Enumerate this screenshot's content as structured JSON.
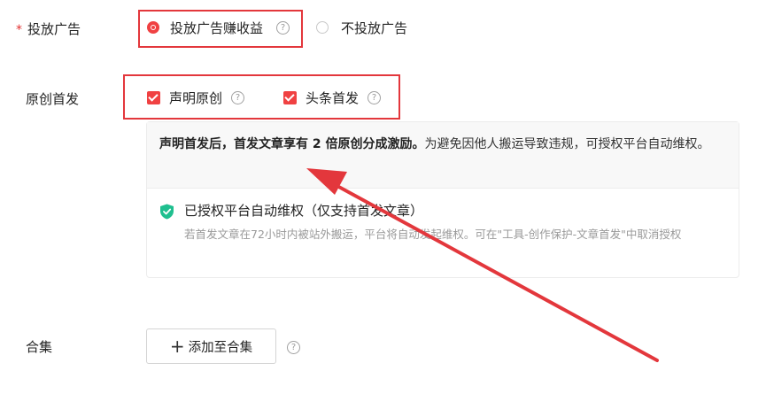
{
  "ad_row": {
    "label": "投放广告",
    "option_on": "投放广告赚收益",
    "option_off": "不投放广告"
  },
  "original_row": {
    "label": "原创首发",
    "declare_original": "声明原创",
    "first_publish": "头条首发"
  },
  "info_panel": {
    "bold_text": "声明首发后，首发文章享有 2 倍原创分成激励。",
    "normal_text": "为避免因他人搬运导致违规，可授权平台自动维权。",
    "auth_title": "已授权平台自动维权（仅支持首发文章）",
    "auth_desc": "若首发文章在72小时内被站外搬运，平台将自动发起维权。可在\"工具-创作保护-文章首发\"中取消授权"
  },
  "collection_row": {
    "label": "合集",
    "add_button": "添加至合集"
  },
  "colors": {
    "accent": "#f04142",
    "annotation_red": "#e3373c",
    "shield_green": "#1fbf8f"
  },
  "icons": [
    "help-icon",
    "shield-check-icon",
    "plus-icon"
  ]
}
